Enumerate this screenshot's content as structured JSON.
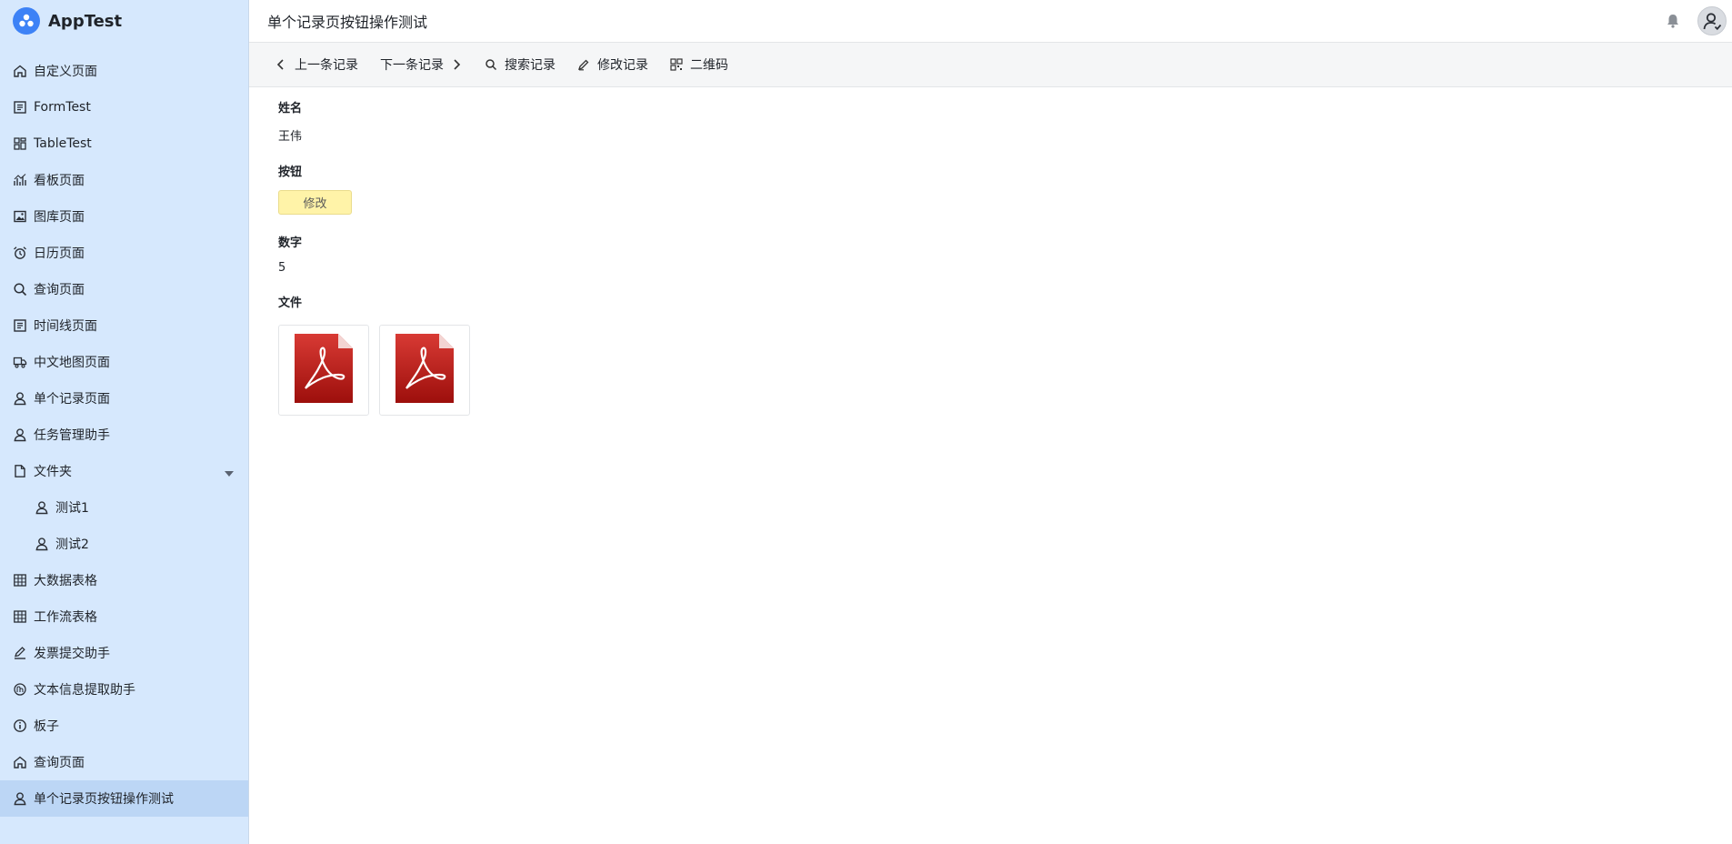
{
  "app": {
    "name": "AppTest",
    "brand_color": "#3d82f6"
  },
  "sidebar": {
    "items": [
      {
        "label": "自定义页面",
        "icon": "home-icon"
      },
      {
        "label": "FormTest",
        "icon": "form-icon"
      },
      {
        "label": "TableTest",
        "icon": "grid-icon"
      },
      {
        "label": "看板页面",
        "icon": "chart-icon"
      },
      {
        "label": "图库页面",
        "icon": "image-icon"
      },
      {
        "label": "日历页面",
        "icon": "alarm-icon"
      },
      {
        "label": "查询页面",
        "icon": "search-icon"
      },
      {
        "label": "时间线页面",
        "icon": "form-icon"
      },
      {
        "label": "中文地图页面",
        "icon": "truck-icon"
      },
      {
        "label": "单个记录页面",
        "icon": "user-icon"
      },
      {
        "label": "任务管理助手",
        "icon": "user-icon"
      },
      {
        "label": "文件夹",
        "icon": "file-icon",
        "expanded": true
      },
      {
        "label": "测试1",
        "icon": "user-icon",
        "sub": true
      },
      {
        "label": "测试2",
        "icon": "user-icon",
        "sub": true
      },
      {
        "label": "大数据表格",
        "icon": "table-icon"
      },
      {
        "label": "工作流表格",
        "icon": "table-icon"
      },
      {
        "label": "发票提交助手",
        "icon": "pen-icon"
      },
      {
        "label": "文本信息提取助手",
        "icon": "ai-icon"
      },
      {
        "label": "板子",
        "icon": "info-icon"
      },
      {
        "label": "查询页面",
        "icon": "home-icon"
      },
      {
        "label": "单个记录页按钮操作测试",
        "icon": "user-icon",
        "active": true
      }
    ]
  },
  "header": {
    "title": "单个记录页按钮操作测试"
  },
  "toolbar": {
    "prev_label": "上一条记录",
    "next_label": "下一条记录",
    "search_label": "搜索记录",
    "edit_label": "修改记录",
    "qrcode_label": "二维码"
  },
  "record": {
    "name_label": "姓名",
    "name_value": "王伟",
    "button_label": "按钮",
    "button_text": "修改",
    "number_label": "数字",
    "number_value": "5",
    "file_label": "文件",
    "files": [
      "pdf-file-icon",
      "pdf-file-icon"
    ]
  },
  "colors": {
    "sidebar_bg": "#d6e8fd",
    "sidebar_active": "#bcd6f5",
    "edit_button_bg": "#fff3a8",
    "pdf_red": "#c8211e"
  }
}
